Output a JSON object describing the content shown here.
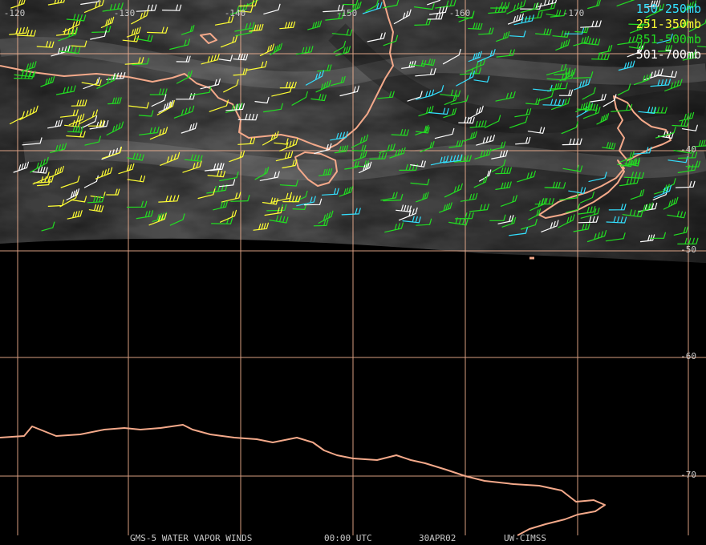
{
  "map": {
    "longitude_labels": [
      "-120",
      "-130",
      "-140",
      "-150",
      "-160",
      "-170"
    ],
    "latitude_labels": [
      "-40",
      "-50",
      "-60",
      "-70"
    ],
    "grid_color": "#f0b090",
    "coast_color": "#f4a98a"
  },
  "legend": [
    {
      "label": "150-250mb",
      "color": "#33e0ff"
    },
    {
      "label": "251-350mb",
      "color": "#ffff33"
    },
    {
      "label": "351-500mb",
      "color": "#22dd22"
    },
    {
      "label": "501-700mb",
      "color": "#ffffff"
    }
  ],
  "footer": {
    "product": "GMS-5 WATER VAPOR WINDS",
    "time": "00:00 UTC",
    "date": "30APR02",
    "source": "UW-CIMSS"
  }
}
